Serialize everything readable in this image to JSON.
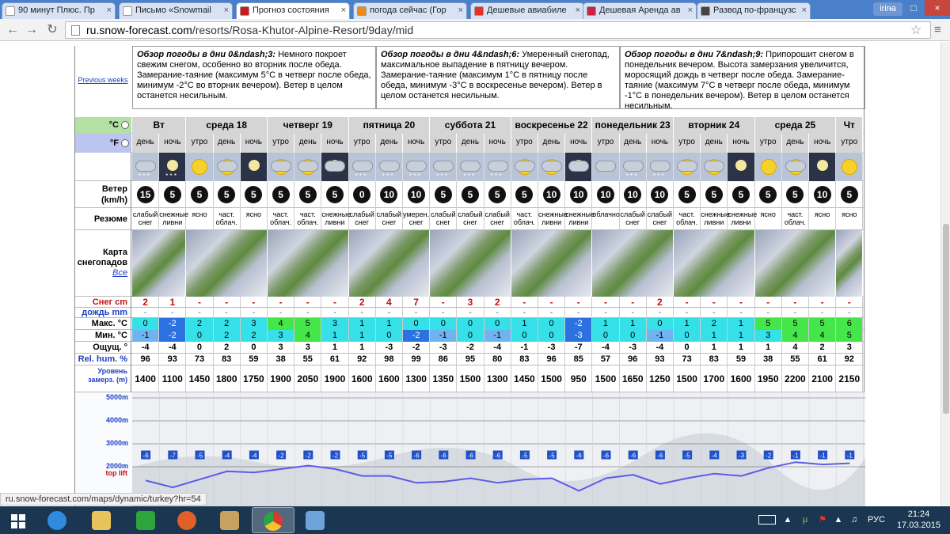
{
  "browser": {
    "tabs": [
      {
        "title": "90 минут Плюс. Пр",
        "icon": "page-icon",
        "color": "#ffffff"
      },
      {
        "title": "Письмо «Snowmail",
        "icon": "page-icon",
        "color": "#ffffff"
      },
      {
        "title": "Прогноз состояния",
        "icon": "snow-forecast-icon",
        "color": "#d01a1a"
      },
      {
        "title": "погода сейчас (Гор",
        "icon": "weather-icon",
        "color": "#f08a16"
      },
      {
        "title": "Дешевые авиабиле",
        "icon": "a-icon",
        "color": "#e63323"
      },
      {
        "title": "Дешевая Аренда ав",
        "icon": "car-icon",
        "color": "#cc2244"
      },
      {
        "title": "Развод по-французс",
        "icon": "face-icon",
        "color": "#444444"
      }
    ],
    "user": "irina",
    "url_domain": "ru.snow-forecast.com",
    "url_path": "/resorts/Rosa-Khutor-Alpine-Resort/9day/mid",
    "status_url": "ru.snow-forecast.com/maps/dynamic/turkey?hr=54"
  },
  "page": {
    "prev_weeks": "Previous weeks",
    "reviews": [
      {
        "heading": "Обзор погоды в дни 0&ndash;3:",
        "text": " Немного покроет свежим снегом, особенно во вторник после обеда. Замерание-таяние (максимум 5°C в четверг после обеда, минимум -2°C во вторник вечером). Ветер в целом останется несильным."
      },
      {
        "heading": "Обзор погоды в дни 4&ndash;6:",
        "text": " Умеренный снегопад, максимальное выпадение в пятницу вечером. Замерание-таяние (максимум 1°C в пятницу после обеда, минимум -3°C в воскресенье вечером). Ветер в целом останется несильным."
      },
      {
        "heading": "Обзор погоды в дни 7&ndash;9:",
        "text": " Припорошит снегом в понедельник вечером. Высота замерзания увеличится, моросящий дождь в четверг после обеда. Замерание-таяние (максимум 7°C в четверг после обеда, минимум -1°C в понедельник вечером). Ветер в целом останется несильным."
      }
    ],
    "units": {
      "c": "°C",
      "f": "°F"
    },
    "days": [
      {
        "name": "Вт",
        "cols": 2
      },
      {
        "name": "среда 18",
        "cols": 3
      },
      {
        "name": "четверг 19",
        "cols": 3
      },
      {
        "name": "пятница 20",
        "cols": 3
      },
      {
        "name": "суббота 21",
        "cols": 3
      },
      {
        "name": "воскресенье 22",
        "cols": 3
      },
      {
        "name": "понедельник 23",
        "cols": 3
      },
      {
        "name": "вторник 24",
        "cols": 3
      },
      {
        "name": "среда 25",
        "cols": 3
      },
      {
        "name": "Чт",
        "cols": 1
      }
    ],
    "periods": [
      "день",
      "ночь",
      "утро",
      "день",
      "ночь",
      "утро",
      "день",
      "ночь",
      "утро",
      "день",
      "ночь",
      "утро",
      "день",
      "ночь",
      "утро",
      "день",
      "ночь",
      "утро",
      "день",
      "ночь",
      "утро",
      "день",
      "ночь",
      "утро",
      "день",
      "ночь",
      "утро"
    ],
    "labels": {
      "wind": "Ветер (km/h)",
      "summary": "Резюме",
      "map": "Карта снегопадов",
      "map_all": "Все",
      "snow": "Снег cm",
      "rain": "дождь mm",
      "max": "Макс. °C",
      "min": "Мин. °C",
      "feel": "Ощущ. °",
      "hum": "Rel. hum. %",
      "frz": "Уровень замерз. (m)"
    },
    "wind": [
      15,
      5,
      5,
      5,
      5,
      5,
      5,
      5,
      0,
      10,
      10,
      5,
      5,
      5,
      5,
      10,
      10,
      10,
      10,
      10,
      5,
      5,
      5,
      5,
      5,
      10,
      5
    ],
    "summary": [
      "слабый снег",
      "снежные ливни",
      "ясно",
      "част. облач.",
      "ясно",
      "част. облач.",
      "част. облач.",
      "снежные ливни",
      "слабый снег",
      "слабый снег",
      "умерен. снег",
      "слабый снег",
      "слабый снег",
      "слабый снег",
      "част. облач.",
      "снежные ливни",
      "снежные ливни",
      "облачно",
      "слабый снег",
      "слабый снег",
      "част. облач.",
      "снежные ливни",
      "снежные ливни",
      "ясно",
      "част. облач.",
      "ясно",
      "ясно"
    ],
    "snow": [
      "2",
      "1",
      "-",
      "-",
      "-",
      "-",
      "-",
      "-",
      "2",
      "4",
      "7",
      "-",
      "3",
      "2",
      "-",
      "-",
      "-",
      "-",
      "-",
      "2",
      "-",
      "-",
      "-",
      "-",
      "-",
      "-",
      "-"
    ],
    "rain": [
      "-",
      "-",
      "-",
      "-",
      "-",
      "-",
      "-",
      "-",
      "-",
      "-",
      "-",
      "-",
      "-",
      "-",
      "-",
      "-",
      "-",
      "-",
      "-",
      "-",
      "-",
      "-",
      "-",
      "-",
      "-",
      "-",
      "-"
    ],
    "tmax": [
      0,
      -2,
      2,
      2,
      3,
      4,
      5,
      3,
      1,
      1,
      0,
      0,
      0,
      0,
      1,
      0,
      -2,
      1,
      1,
      0,
      1,
      2,
      1,
      5,
      5,
      5,
      6
    ],
    "tmin": [
      -1,
      -2,
      0,
      2,
      2,
      3,
      4,
      1,
      1,
      0,
      -2,
      -1,
      0,
      -1,
      0,
      0,
      -3,
      0,
      0,
      -1,
      0,
      1,
      1,
      3,
      4,
      4,
      5
    ],
    "feel": [
      -4,
      -4,
      0,
      2,
      0,
      3,
      3,
      1,
      1,
      -3,
      -2,
      -3,
      -2,
      -4,
      -1,
      -3,
      -7,
      -4,
      -3,
      -4,
      0,
      1,
      1,
      1,
      4,
      2,
      3
    ],
    "hum": [
      96,
      93,
      73,
      83,
      59,
      38,
      55,
      61,
      92,
      98,
      99,
      86,
      95,
      80,
      83,
      96,
      85,
      57,
      96,
      93,
      73,
      83,
      59,
      38,
      55,
      61,
      92
    ],
    "frz": [
      1400,
      1100,
      1450,
      1800,
      1750,
      1900,
      2050,
      1900,
      1600,
      1600,
      1300,
      1350,
      1500,
      1300,
      1450,
      1500,
      950,
      1500,
      1650,
      1250,
      1500,
      1700,
      1600,
      1950,
      2200,
      2100,
      2150
    ],
    "icons": [
      "cloud-snow",
      "moon-snow",
      "sun",
      "sun-cloud",
      "moon",
      "sun-cloud",
      "sun-cloud",
      "moon-cloud",
      "cloud-snow",
      "cloud-snow",
      "cloud-snow",
      "cloud-snow",
      "cloud-snow",
      "cloud-snow",
      "sun-cloud",
      "sun-cloud",
      "moon-cloud",
      "cloud",
      "cloud-snow",
      "cloud-snow",
      "sun-cloud",
      "sun-cloud",
      "moon",
      "sun",
      "sun-cloud",
      "moon",
      "sun"
    ],
    "chart": {
      "y_labels": [
        "5000m",
        "4000m",
        "3000m",
        "2000m"
      ],
      "top_lift": "top lift",
      "temps": [
        -6,
        -7,
        -5,
        -4,
        -4,
        -2,
        -2,
        -2,
        -5,
        -5,
        -6,
        -6,
        -6,
        -6,
        -5,
        -5,
        -6,
        -6,
        -6,
        -6,
        -5,
        -4,
        -3,
        -2,
        -1,
        -1,
        -1
      ]
    }
  },
  "taskbar": {
    "lang": "РУС",
    "time": "21:24",
    "date": "17.03.2015"
  }
}
